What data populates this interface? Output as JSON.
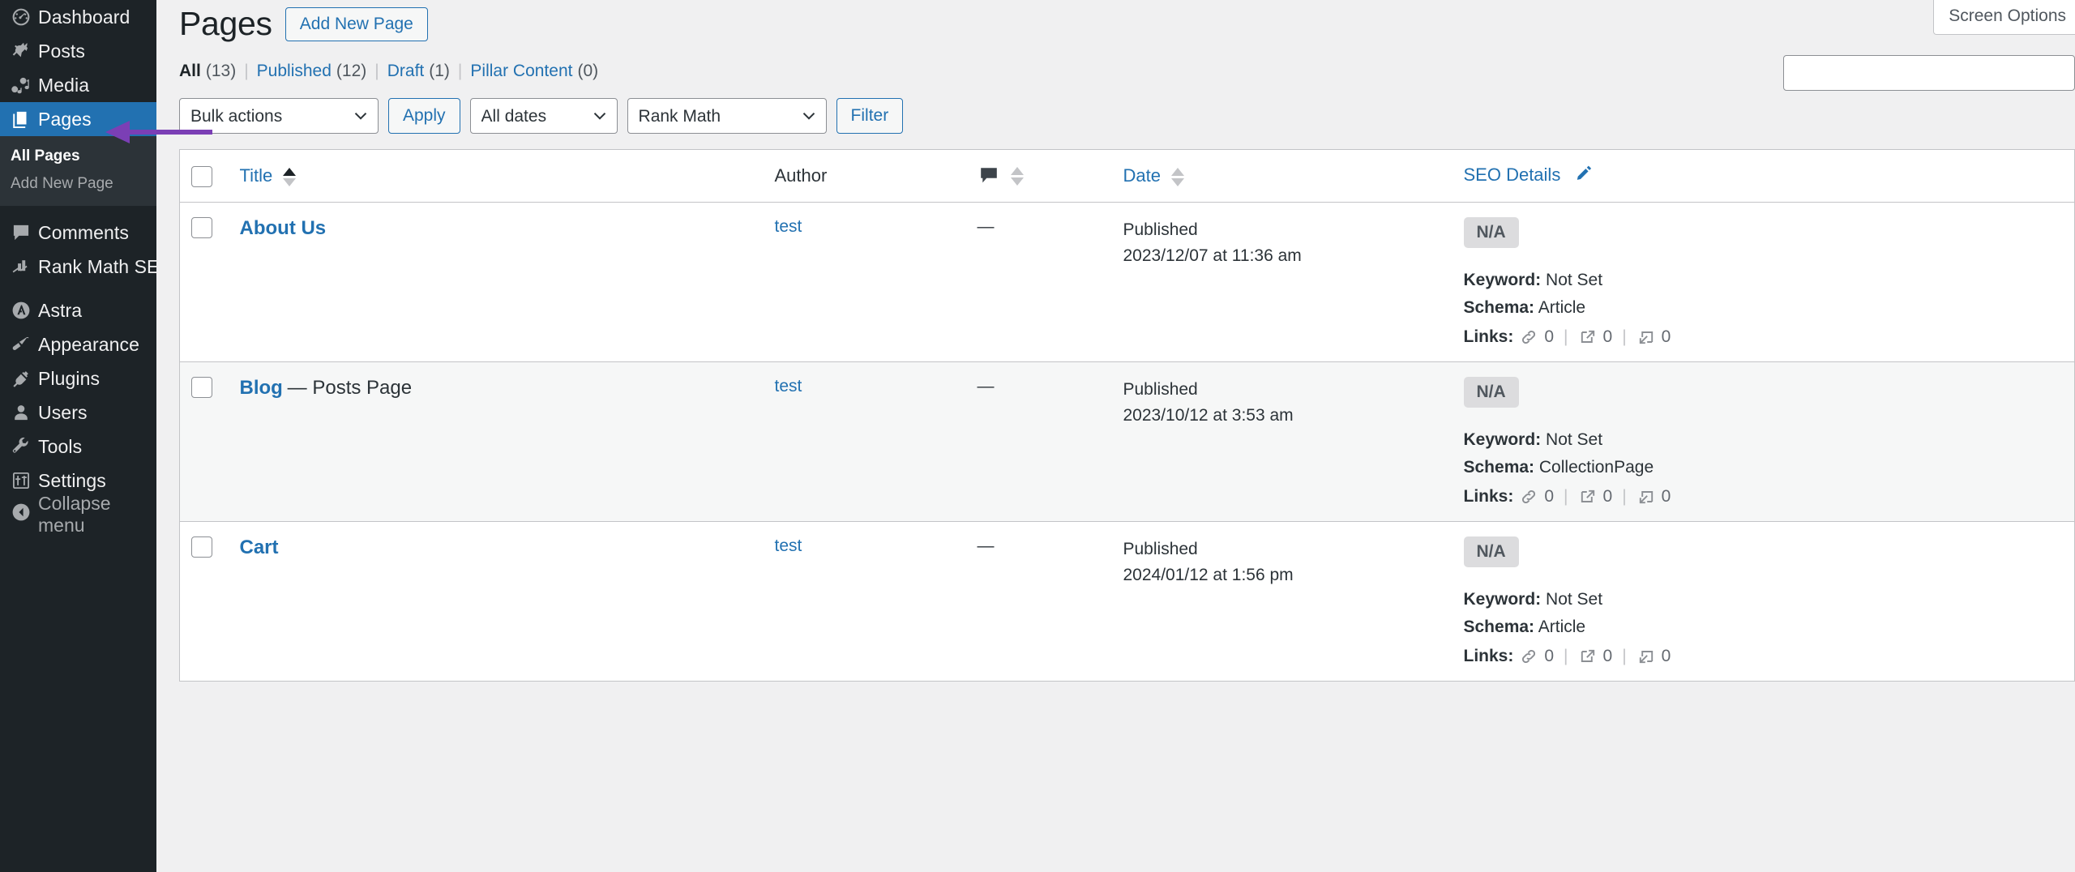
{
  "sidebar": {
    "items": [
      {
        "label": "Dashboard",
        "icon": "dashboard-icon"
      },
      {
        "label": "Posts",
        "icon": "pin-icon"
      },
      {
        "label": "Media",
        "icon": "media-icon"
      },
      {
        "label": "Pages",
        "icon": "pages-icon",
        "current": true
      },
      {
        "label": "Comments",
        "icon": "comment-icon"
      },
      {
        "label": "Rank Math SEO",
        "icon": "rankmath-icon"
      },
      {
        "label": "Astra",
        "icon": "astra-icon"
      },
      {
        "label": "Appearance",
        "icon": "paintbrush-icon"
      },
      {
        "label": "Plugins",
        "icon": "plug-icon"
      },
      {
        "label": "Users",
        "icon": "user-icon"
      },
      {
        "label": "Tools",
        "icon": "wrench-icon"
      },
      {
        "label": "Settings",
        "icon": "settings-icon"
      }
    ],
    "submenu": [
      {
        "label": "All Pages",
        "active": true
      },
      {
        "label": "Add New Page",
        "active": false
      }
    ],
    "collapse_label": "Collapse menu",
    "highlight_color": "#2271b1",
    "background_color": "#1d2327"
  },
  "screen_meta": {
    "screen_options_label": "Screen Options"
  },
  "header": {
    "title": "Pages",
    "add_new_label": "Add New Page"
  },
  "search": {
    "value": "",
    "placeholder": ""
  },
  "status_filters": [
    {
      "label": "All",
      "count": "(13)",
      "current": true
    },
    {
      "label": "Published",
      "count": "(12)",
      "current": false
    },
    {
      "label": "Draft",
      "count": "(1)",
      "current": false
    },
    {
      "label": "Pillar Content",
      "count": "(0)",
      "current": false
    }
  ],
  "tablenav": {
    "bulk_actions_value": "Bulk actions",
    "apply_label": "Apply",
    "dates_value": "All dates",
    "rankmath_value": "Rank Math",
    "filter_label": "Filter"
  },
  "table": {
    "columns": {
      "title": "Title",
      "author": "Author",
      "comments_icon": "comment-icon",
      "date": "Date",
      "seo_details": "SEO Details",
      "seo_edit_icon": "pencil-icon"
    },
    "rows": [
      {
        "title": "About Us",
        "title_suffix": "",
        "author": "test",
        "comments": "—",
        "date_status": "Published",
        "date_value": "2023/12/07 at 11:36 am",
        "seo_score": "N/A",
        "keyword_label": "Keyword:",
        "keyword_value": "Not Set",
        "schema_label": "Schema:",
        "schema_value": "Article",
        "links_label": "Links:",
        "links_internal": "0",
        "links_external": "0",
        "links_incoming": "0"
      },
      {
        "title": "Blog",
        "title_suffix": "— Posts Page",
        "author": "test",
        "comments": "—",
        "date_status": "Published",
        "date_value": "2023/10/12 at 3:53 am",
        "seo_score": "N/A",
        "keyword_label": "Keyword:",
        "keyword_value": "Not Set",
        "schema_label": "Schema:",
        "schema_value": "CollectionPage",
        "links_label": "Links:",
        "links_internal": "0",
        "links_external": "0",
        "links_incoming": "0"
      },
      {
        "title": "Cart",
        "title_suffix": "",
        "author": "test",
        "comments": "—",
        "date_status": "Published",
        "date_value": "2024/01/12 at 1:56 pm",
        "seo_score": "N/A",
        "keyword_label": "Keyword:",
        "keyword_value": "Not Set",
        "schema_label": "Schema:",
        "schema_value": "Article",
        "links_label": "Links:",
        "links_internal": "0",
        "links_external": "0",
        "links_incoming": "0"
      }
    ]
  },
  "annotation": {
    "arrow_color": "#7b3fb5"
  }
}
